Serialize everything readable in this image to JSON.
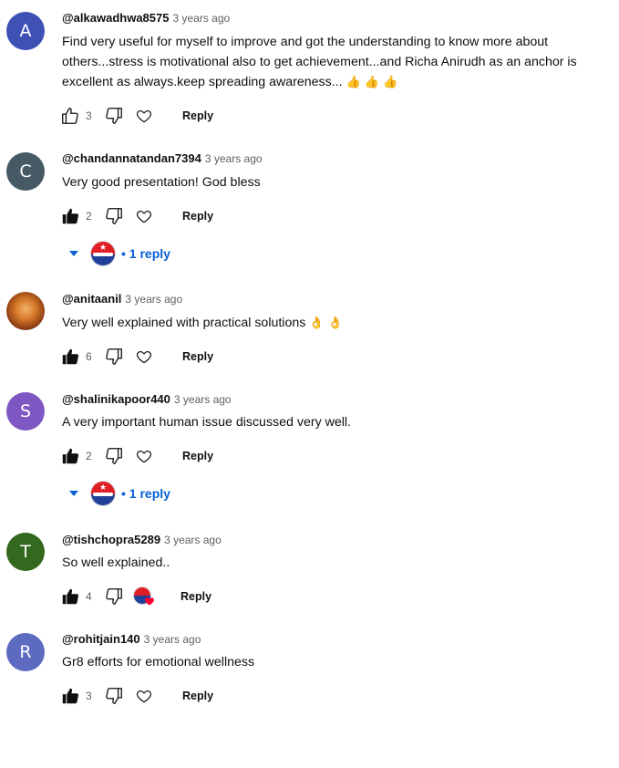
{
  "colors": {
    "avatar_a": "#3f51b5",
    "avatar_c": "#455a64",
    "avatar_s": "#7e57c2",
    "avatar_t": "#33691e",
    "avatar_r": "#5c6bc0",
    "link_blue": "#065fd4"
  },
  "comments": [
    {
      "avatar_letter": "A",
      "author": "@alkawadhwa8575",
      "time": "3 years ago",
      "text": "Find very useful for myself to improve and got the understanding to know more about others...stress is motivational also to get achievement...and Richa Anirudh as an anchor is excellent as always.keep spreading awareness...",
      "emoji": "👍 👍 👍",
      "likes": "3",
      "liked": false,
      "reply_label": "Reply"
    },
    {
      "avatar_letter": "C",
      "author": "@chandannatandan7394",
      "time": "3 years ago",
      "text": "Very good presentation! God bless",
      "likes": "2",
      "liked": true,
      "reply_label": "Reply",
      "replies_label": "• 1 reply"
    },
    {
      "avatar_letter": "",
      "author": "@anitaanil",
      "time": "3 years ago",
      "text": "Very well explained with practical solutions",
      "emoji": "👌 👌",
      "likes": "6",
      "liked": true,
      "reply_label": "Reply"
    },
    {
      "avatar_letter": "S",
      "author": "@shalinikapoor440",
      "time": "3 years ago",
      "text": "A very important human issue  discussed very well.",
      "likes": "2",
      "liked": true,
      "reply_label": "Reply",
      "replies_label": "• 1 reply"
    },
    {
      "avatar_letter": "T",
      "author": "@tishchopra5289",
      "time": "3 years ago",
      "text": "So well explained..",
      "likes": "4",
      "liked": true,
      "reply_label": "Reply",
      "creator_hearted": true
    },
    {
      "avatar_letter": "R",
      "author": "@rohitjain140",
      "time": "3 years ago",
      "text": "Gr8 efforts for emotional wellness",
      "likes": "3",
      "liked": true,
      "reply_label": "Reply"
    }
  ]
}
